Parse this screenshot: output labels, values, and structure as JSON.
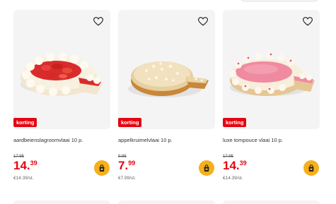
{
  "products": [
    {
      "name": "aardbeienslagroomvlaai 10 p.",
      "badge": "korting",
      "old_price": "17.95",
      "price_euros": "14.",
      "price_cents": "39",
      "unit_price": "€14.39/st."
    },
    {
      "name": "appelkruimelvlaai 10 p.",
      "badge": "korting",
      "old_price": "9.95",
      "price_euros": "7.",
      "price_cents": "99",
      "unit_price": "€7.99/st."
    },
    {
      "name": "luxe tompouce vlaai 10 p.",
      "badge": "korting",
      "old_price": "17.95",
      "price_euros": "14.",
      "price_cents": "39",
      "unit_price": "€14.39/st."
    }
  ],
  "colors": {
    "badge_red": "#e30613",
    "price_red": "#e30613",
    "cart_yellow": "#f5b01a",
    "image_bg": "#f4f4f4"
  },
  "icons": {
    "favorite": "heart-icon",
    "cart": "shopping-bag-icon"
  }
}
